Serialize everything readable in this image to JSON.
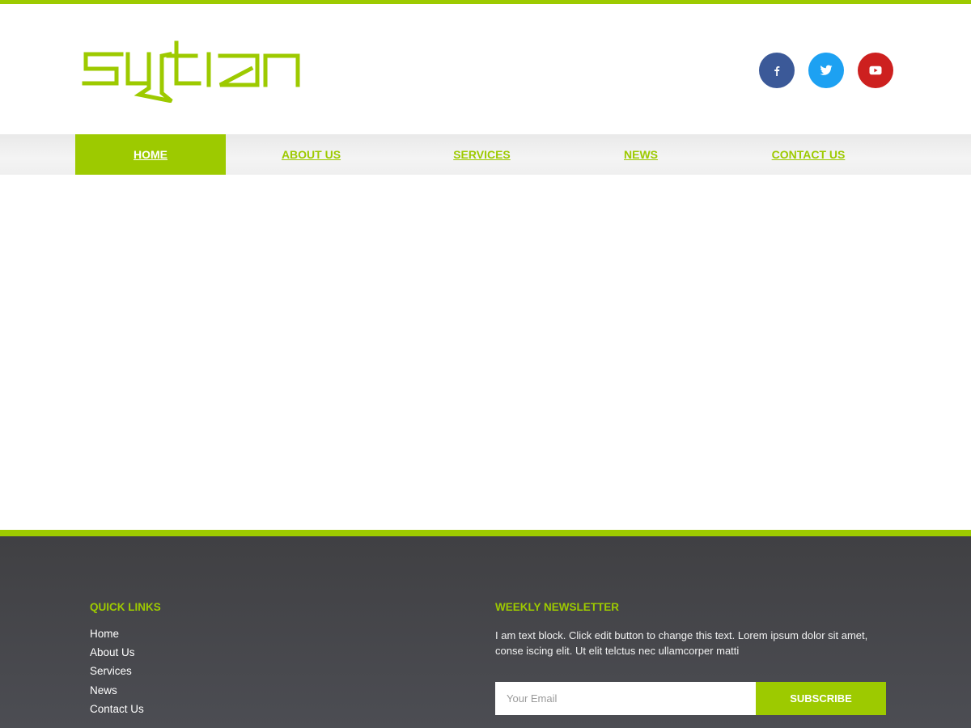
{
  "colors": {
    "accent": "#9dca00",
    "footer_bg": "#45464a",
    "facebook": "#3b5998",
    "twitter": "#1da1f2",
    "youtube": "#cd201f"
  },
  "header": {
    "logo_text": "syntian",
    "social": [
      {
        "name": "facebook",
        "icon": "facebook-icon"
      },
      {
        "name": "twitter",
        "icon": "twitter-icon"
      },
      {
        "name": "youtube",
        "icon": "youtube-icon"
      }
    ]
  },
  "nav": {
    "items": [
      {
        "label": "HOME",
        "active": true
      },
      {
        "label": "ABOUT US",
        "active": false
      },
      {
        "label": "SERVICES",
        "active": false
      },
      {
        "label": "NEWS",
        "active": false
      },
      {
        "label": "CONTACT US",
        "active": false
      }
    ]
  },
  "footer": {
    "quick_links": {
      "heading": "QUICK LINKS",
      "items": [
        "Home",
        "About Us",
        "Services",
        "News",
        "Contact Us"
      ]
    },
    "newsletter": {
      "heading": "WEEKLY NEWSLETTER",
      "text": "I am text block. Click edit button to change this text. Lorem ipsum dolor sit amet, conse iscing elit. Ut elit telctus nec ullamcorper matti",
      "email_placeholder": "Your Email",
      "email_value": "",
      "subscribe_label": "SUBSCRIBE"
    }
  }
}
